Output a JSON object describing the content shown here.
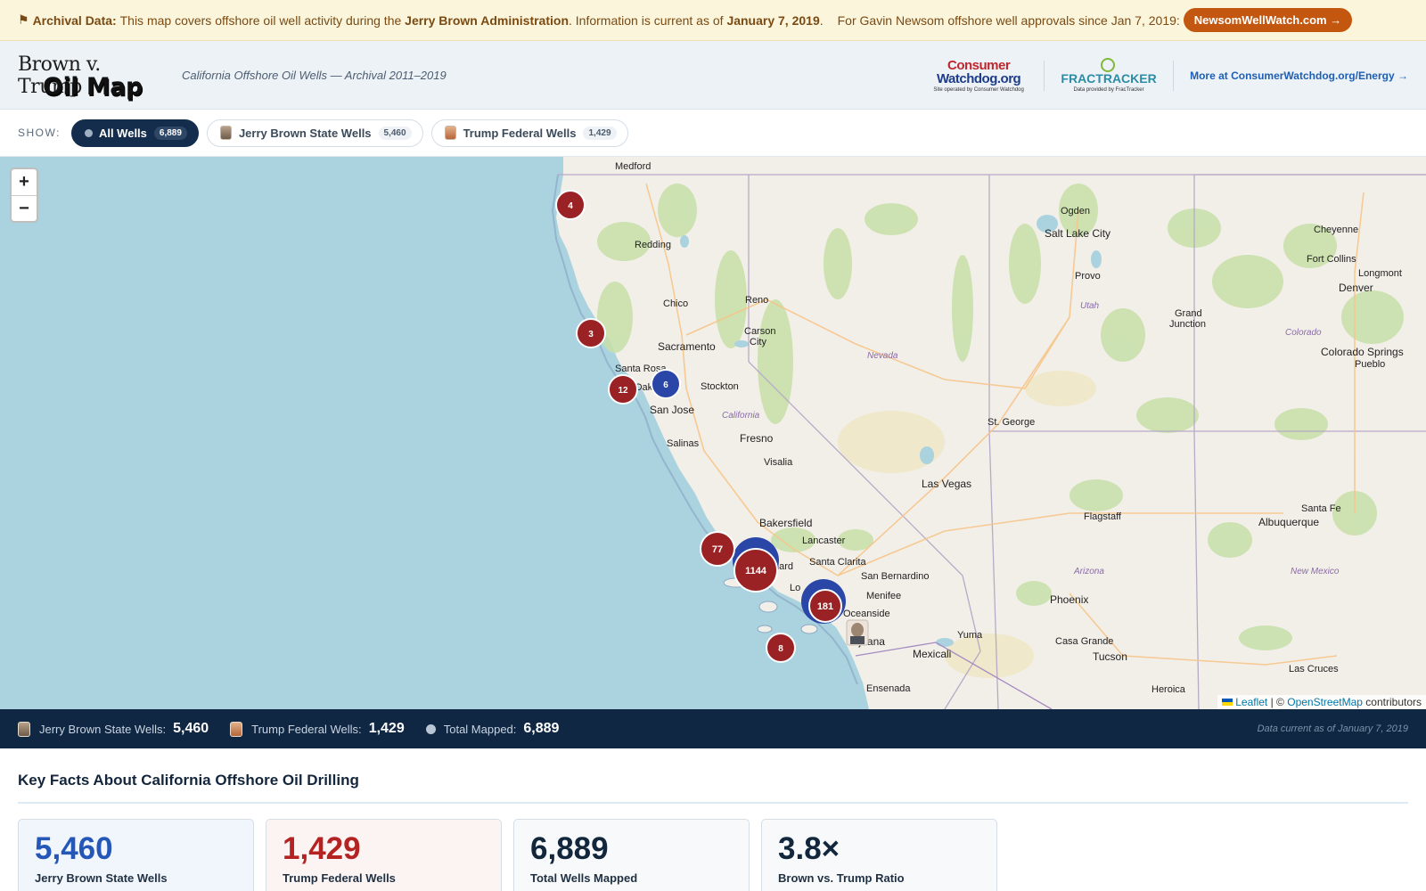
{
  "banner": {
    "flag_icon": "⚑",
    "lead": "Archival Data:",
    "text1": "This map covers offshore oil well activity during the",
    "admin": "Jerry Brown Administration",
    "text2": ". Information is current as of",
    "date": "January 7, 2019",
    "text3": ".",
    "newsom_text": "For Gavin Newsom offshore well approvals since Jan 7, 2019:",
    "newsom_button": "NewsomWellWatch.com →"
  },
  "header": {
    "logo_line1": "Brown v. Trump",
    "logo_line2": "Oil Map",
    "subtitle": "California Offshore Oil Wells — Archival 2011–2019",
    "cw_name_a": "Consumer",
    "cw_name_b": "Watchdog.org",
    "cw_sub": "Site operated by Consumer Watchdog",
    "ft_name": "FRACTRACKER",
    "ft_sub": "Data provided by FracTracker",
    "more_link": "More at ConsumerWatchdog.org/Energy →"
  },
  "filter": {
    "show_label": "SHOW:",
    "all": {
      "label": "All Wells",
      "count": "6,889"
    },
    "brown": {
      "label": "Jerry Brown State Wells",
      "count": "5,460"
    },
    "trump": {
      "label": "Trump Federal Wells",
      "count": "1,429"
    }
  },
  "map": {
    "zoom_in": "+",
    "zoom_out": "−",
    "attribution": {
      "leaflet": "Leaflet",
      "sep": "| ©",
      "osm": "OpenStreetMap",
      "contributors": "contributors"
    },
    "colors": {
      "water": "#aad3df",
      "land": "#f2efe9",
      "trump_cluster": "#9b2224",
      "brown_cluster": "#2a47a8"
    },
    "clusters": [
      {
        "label": "4",
        "kind": "trump"
      },
      {
        "label": "3",
        "kind": "trump"
      },
      {
        "label": "12",
        "kind": "trump"
      },
      {
        "label": "6",
        "kind": "brown"
      },
      {
        "label": "77",
        "kind": "trump"
      },
      {
        "label": "1144",
        "kind": "trump"
      },
      {
        "label": "181",
        "kind": "trump"
      },
      {
        "label": "8",
        "kind": "trump"
      }
    ],
    "places": {
      "medford": "Medford",
      "redding": "Redding",
      "chico": "Chico",
      "reno": "Reno",
      "carson": "Carson",
      "city": "City",
      "sacramento": "Sacramento",
      "santa_rosa": "Santa Rosa",
      "stockton": "Stockton",
      "oak": "Oak",
      "san_jose": "San Jose",
      "salinas": "Salinas",
      "california": "California",
      "fresno": "Fresno",
      "visalia": "Visalia",
      "nevada": "Nevada",
      "bakersfield": "Bakersfield",
      "lancaster": "Lancaster",
      "santa_clarita": "Santa Clarita",
      "nard": "nard",
      "lo": "Lo",
      "san_bernardino": "San Bernardino",
      "menifee": "Menifee",
      "oceanside": "Oceanside",
      "tijuana": "Tijuana",
      "mexicali": "Mexicali",
      "yuma": "Yuma",
      "ensenada": "Ensenada",
      "las_vegas": "Las Vegas",
      "st_george": "St. George",
      "flagstaff": "Flagstaff",
      "phoenix": "Phoenix",
      "arizona": "Arizona",
      "casa_grande": "Casa Grande",
      "tucson": "Tucson",
      "heroica": "Heroica",
      "ogden": "Ogden",
      "salt_lake_city": "Salt Lake City",
      "provo": "Provo",
      "utah": "Utah",
      "grand": "Grand",
      "junction": "Junction",
      "cheyenne": "Cheyenne",
      "fort_collins": "Fort Collins",
      "longmont": "Longmont",
      "denver": "Denver",
      "colorado": "Colorado",
      "colorado_springs": "Colorado Springs",
      "pueblo": "Pueblo",
      "santa_fe": "Santa Fe",
      "albuquerque": "Albuquerque",
      "new_mexico": "New Mexico",
      "las_cruces": "Las Cruces"
    }
  },
  "stats": {
    "brown_label": "Jerry Brown State Wells:",
    "brown_value": "5,460",
    "trump_label": "Trump Federal Wells:",
    "trump_value": "1,429",
    "total_label": "Total Mapped:",
    "total_value": "6,889",
    "data_current": "Data current as of January 7, 2019"
  },
  "facts": {
    "heading": "Key Facts About California Offshore Oil Drilling",
    "cards": [
      {
        "value": "5,460",
        "label": "Jerry Brown State Wells"
      },
      {
        "value": "1,429",
        "label": "Trump Federal Wells"
      },
      {
        "value": "6,889",
        "label": "Total Wells Mapped"
      },
      {
        "value": "3.8×",
        "label": "Brown vs. Trump Ratio"
      }
    ]
  }
}
